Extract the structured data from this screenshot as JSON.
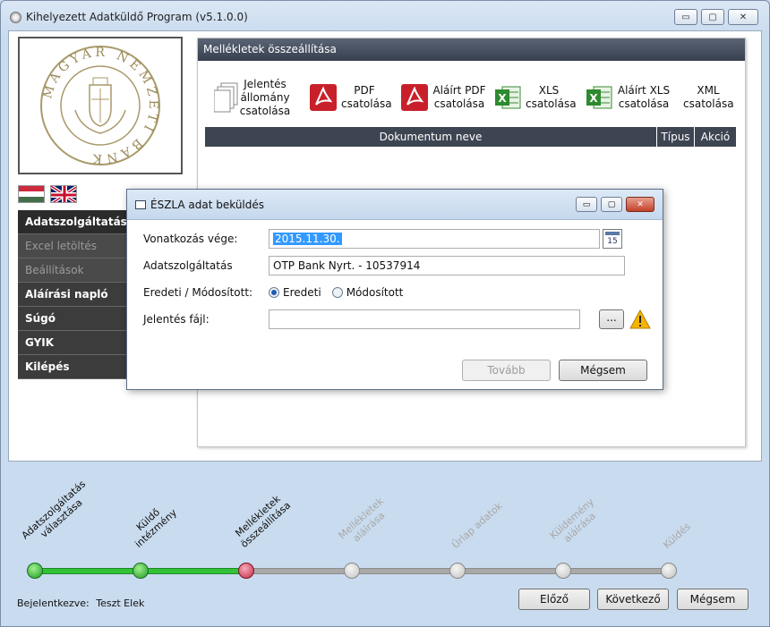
{
  "window": {
    "title": "Kihelyezett Adatküldő Program (v5.1.0.0)"
  },
  "logo": {
    "text": "MAGYAR NEMZETI BANK"
  },
  "flags": [
    "hungarian-flag",
    "uk-flag"
  ],
  "menu": {
    "items": [
      {
        "label": "Adatszolgáltatás",
        "state": "active"
      },
      {
        "label": "Excel letöltés",
        "state": "disabled"
      },
      {
        "label": "Beállítások",
        "state": "disabled"
      },
      {
        "label": "Aláírási napló",
        "state": "normal"
      },
      {
        "label": "Súgó",
        "state": "normal"
      },
      {
        "label": "GYIK",
        "state": "normal"
      },
      {
        "label": "Kilépés",
        "state": "normal"
      }
    ]
  },
  "panel": {
    "title": "Mellékletek összeállítása",
    "attach_buttons": [
      {
        "label": "Jelentés állomány csatolása",
        "icon": "document-icon"
      },
      {
        "label": "PDF csatolása",
        "icon": "pdf-icon"
      },
      {
        "label": "Aláírt PDF csatolása",
        "icon": "pdf-icon"
      },
      {
        "label": "XLS csatolása",
        "icon": "excel-icon"
      },
      {
        "label": "Aláírt XLS csatolása",
        "icon": "excel-icon"
      },
      {
        "label": "XML csatolása",
        "icon": ""
      }
    ],
    "table_headers": {
      "name": "Dokumentum neve",
      "type": "Típus",
      "action": "Akció"
    }
  },
  "dialog": {
    "title": "ÉSZLA adat beküldés",
    "fields": {
      "period_end_label": "Vonatkozás vége:",
      "period_end_value": "2015.11.30.",
      "calendar_day": "15",
      "service_label": "Adatszolgáltatás",
      "service_value": "OTP Bank Nyrt. - 10537914",
      "original_label": "Eredeti / Módosított:",
      "radio_original": "Eredeti",
      "radio_modified": "Módosított",
      "file_label": "Jelentés fájl:",
      "file_value": "",
      "browse_label": "..."
    },
    "buttons": {
      "next": "Tovább",
      "cancel": "Mégsem"
    }
  },
  "wizard": {
    "steps": [
      {
        "label": "Adatszolgáltatás\nválasztása",
        "state": "done"
      },
      {
        "label": "Küldő\nintézmény",
        "state": "done"
      },
      {
        "label": "Mellékletek\nösszeállítása",
        "state": "current"
      },
      {
        "label": "Mellékletek\naláírása",
        "state": "pending"
      },
      {
        "label": "Űrlap adatok",
        "state": "pending"
      },
      {
        "label": "Küldemény\naláírása",
        "state": "pending"
      },
      {
        "label": "Küldés",
        "state": "pending"
      }
    ],
    "logged_in_label": "Bejelentkezve:",
    "user": "Teszt Elek",
    "buttons": {
      "prev": "Előző",
      "next": "Következő",
      "cancel": "Mégsem"
    }
  }
}
